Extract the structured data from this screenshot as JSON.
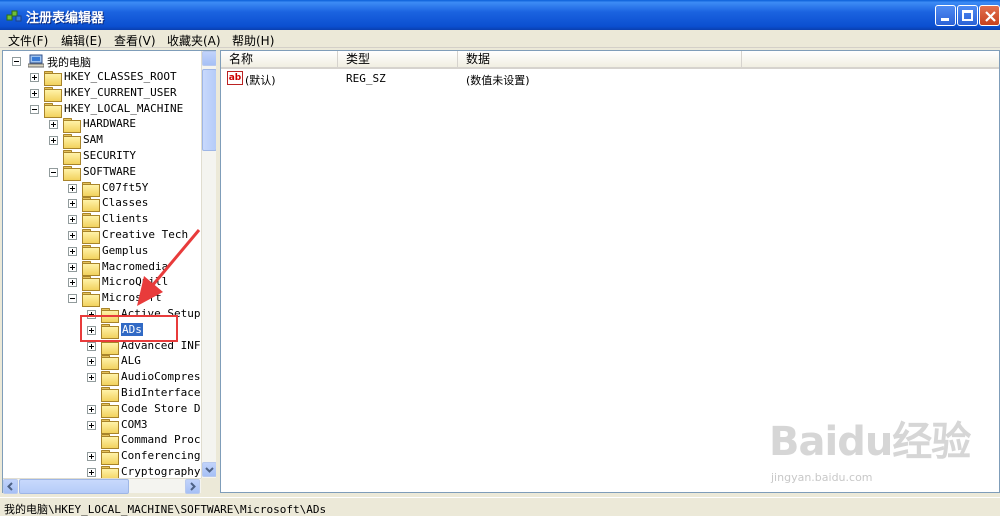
{
  "window": {
    "title": "注册表编辑器",
    "buttons": {
      "minimize": "minimize-icon",
      "maximize": "maximize-icon",
      "close": "close-icon"
    }
  },
  "menu": [
    {
      "label": "文件(F)"
    },
    {
      "label": "编辑(E)"
    },
    {
      "label": "查看(V)"
    },
    {
      "label": "收藏夹(A)"
    },
    {
      "label": "帮助(H)"
    }
  ],
  "tree": {
    "root": "我的电脑",
    "nodes": [
      {
        "label": "HKEY_CLASSES_ROOT",
        "expander": "plus"
      },
      {
        "label": "HKEY_CURRENT_USER",
        "expander": "plus"
      },
      {
        "label": "HKEY_LOCAL_MACHINE",
        "expander": "minus"
      },
      {
        "label": "HARDWARE",
        "expander": "plus"
      },
      {
        "label": "SAM",
        "expander": "plus"
      },
      {
        "label": "SECURITY",
        "expander": "none"
      },
      {
        "label": "SOFTWARE",
        "expander": "minus"
      },
      {
        "label": "C07ft5Y",
        "expander": "plus"
      },
      {
        "label": "Classes",
        "expander": "plus"
      },
      {
        "label": "Clients",
        "expander": "plus"
      },
      {
        "label": "Creative Tech",
        "expander": "plus"
      },
      {
        "label": "Gemplus",
        "expander": "plus"
      },
      {
        "label": "Macromedia",
        "expander": "plus"
      },
      {
        "label": "MicroQuill",
        "expander": "plus"
      },
      {
        "label": "Microsoft",
        "expander": "minus"
      },
      {
        "label": "Active Setup",
        "expander": "plus"
      },
      {
        "label": "ADs",
        "expander": "plus",
        "selected": true
      },
      {
        "label": "Advanced INF",
        "expander": "plus"
      },
      {
        "label": "ALG",
        "expander": "plus"
      },
      {
        "label": "AudioCompress",
        "expander": "plus"
      },
      {
        "label": "BidInterface",
        "expander": "none"
      },
      {
        "label": "Code Store Da",
        "expander": "plus"
      },
      {
        "label": "COM3",
        "expander": "plus"
      },
      {
        "label": "Command Proce",
        "expander": "none"
      },
      {
        "label": "Conferencing",
        "expander": "plus"
      },
      {
        "label": "Cryptography",
        "expander": "plus"
      }
    ]
  },
  "list": {
    "columns": [
      "名称",
      "类型",
      "数据"
    ],
    "rows": [
      {
        "name": "(默认)",
        "type": "REG_SZ",
        "data": "(数值未设置)",
        "icon": "string-value-icon"
      }
    ]
  },
  "status": {
    "path": "我的电脑\\HKEY_LOCAL_MACHINE\\SOFTWARE\\Microsoft\\ADs"
  },
  "watermark": {
    "logo": "Baidu经验",
    "url": "jingyan.baidu.com"
  },
  "colors": {
    "titlebar": "#0b4fd0",
    "selection": "#316ac5",
    "annotation": "#e83b3b"
  }
}
